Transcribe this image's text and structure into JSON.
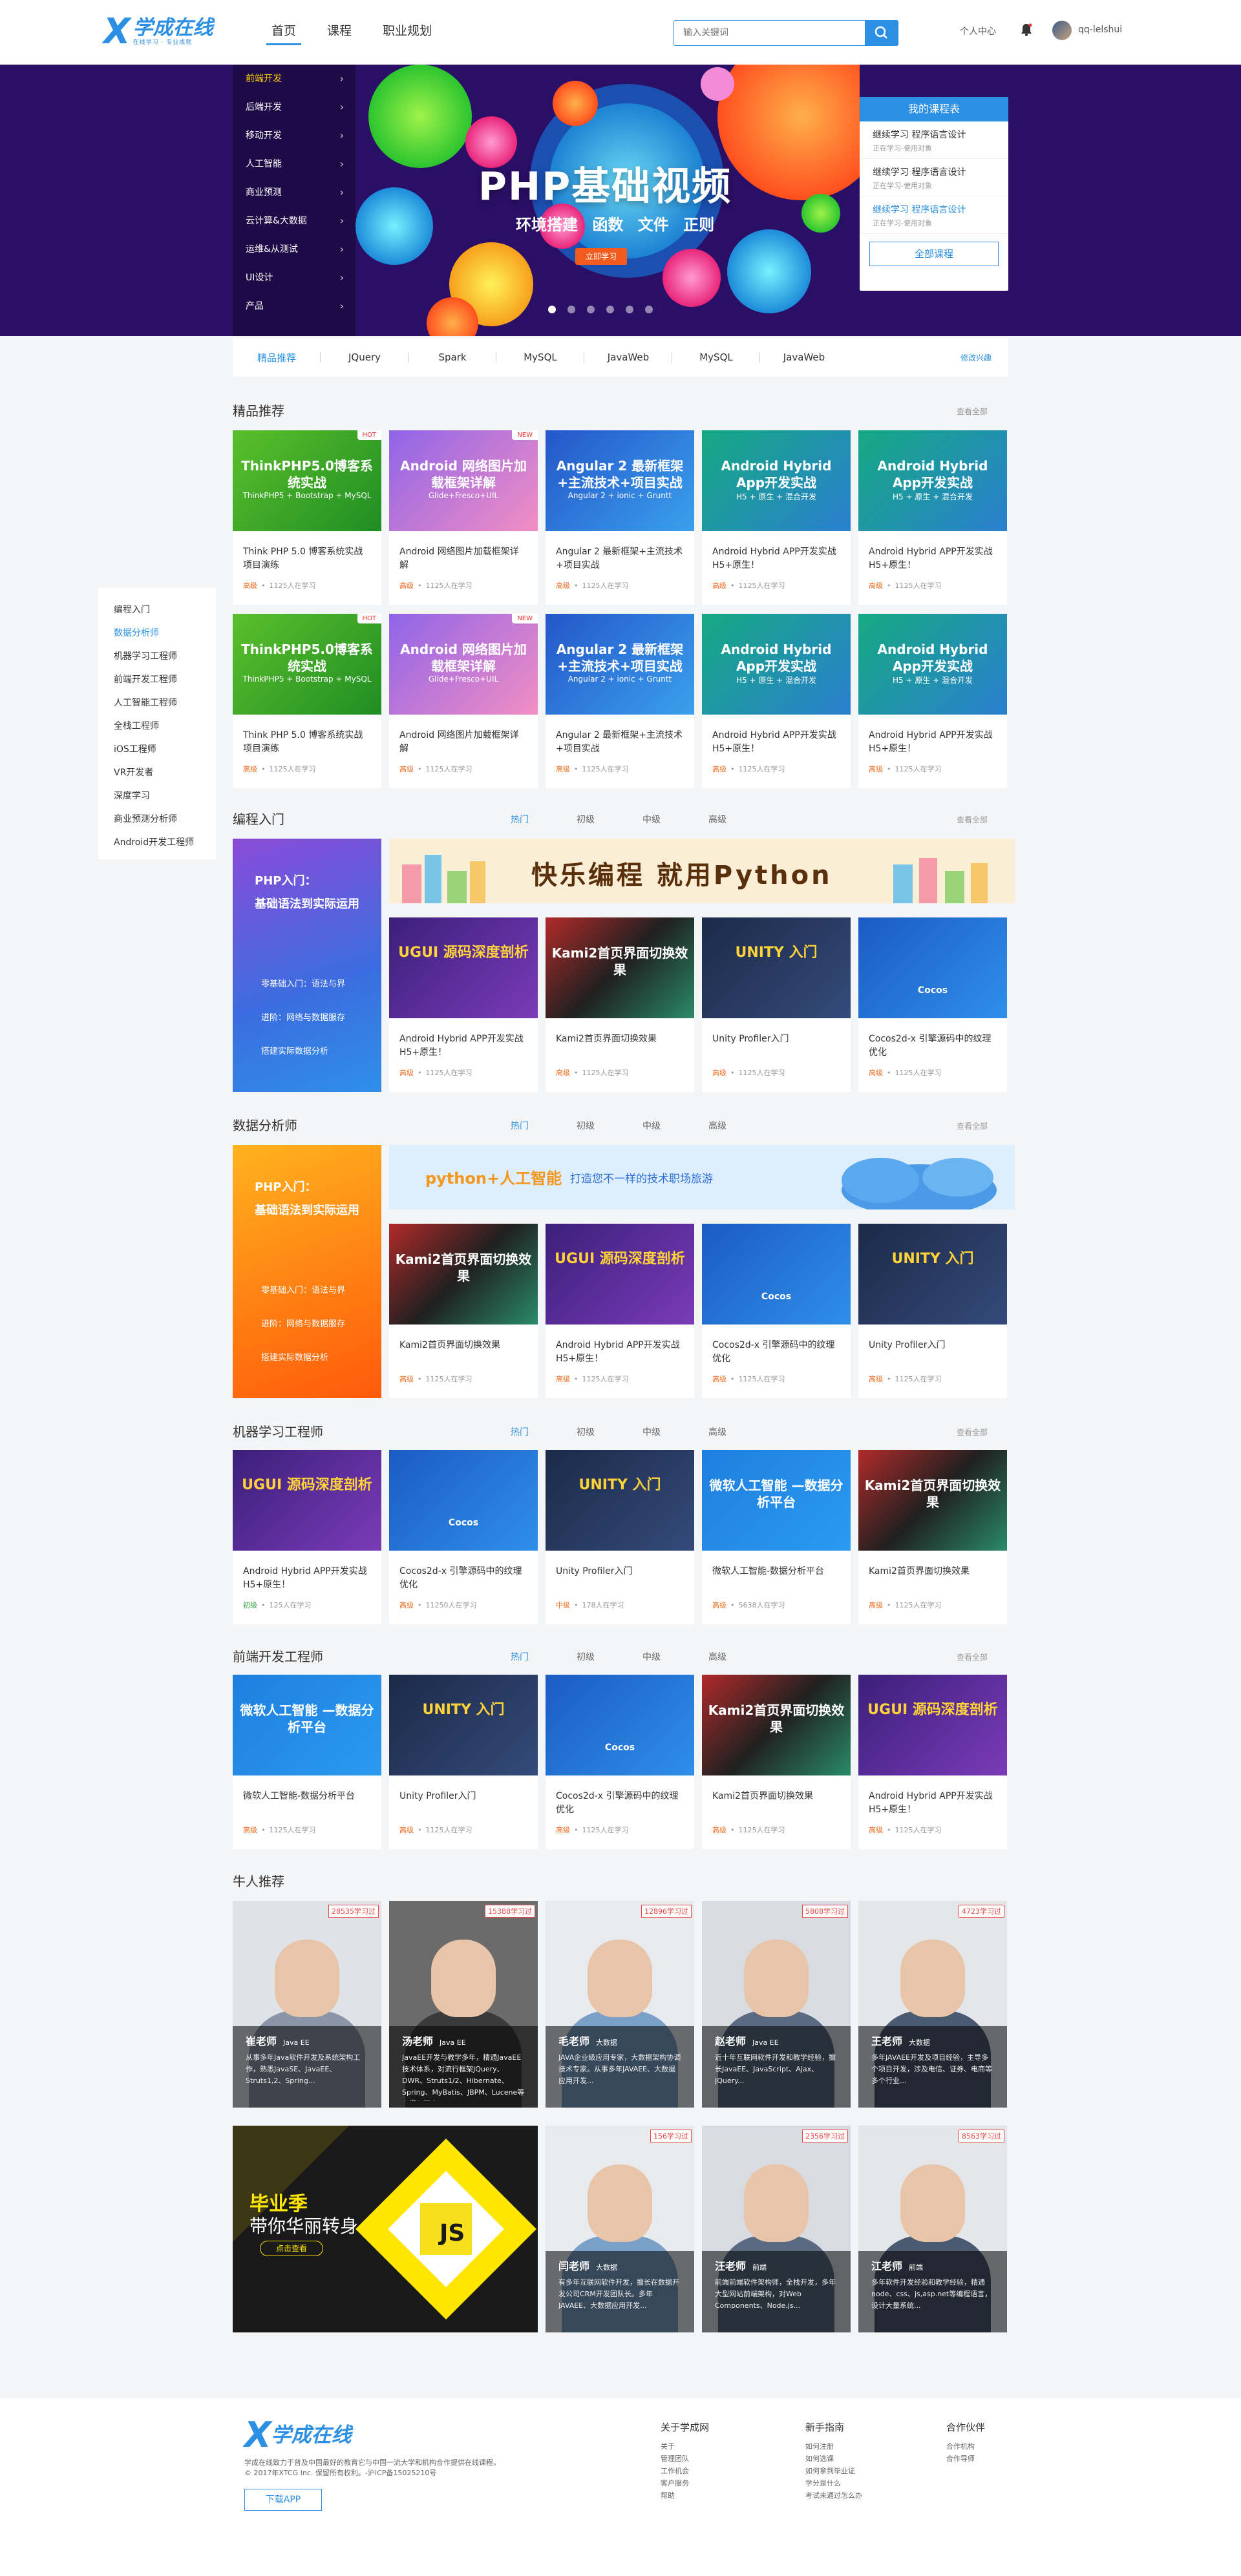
{
  "header": {
    "logo_main": "学成在线",
    "logo_sub": "在线学习 · 专业成就",
    "nav": [
      "首页",
      "课程",
      "职业规划"
    ],
    "search_placeholder": "输入关键词",
    "personal_center": "个人中心",
    "username": "qq-lelshui"
  },
  "banner": {
    "categories": [
      "前端开发",
      "后端开发",
      "移动开发",
      "人工智能",
      "商业预测",
      "云计算&大数据",
      "运维&从测试",
      "UI设计",
      "产品"
    ],
    "slide_title": "PHP基础视频",
    "slide_sub": "环境搭建 函数 文件 正则",
    "slide_button": "立即学习",
    "my_courses": {
      "title": "我的课程表",
      "items": [
        {
          "title": "继续学习 程序语言设计",
          "sub": "正在学习-使用对象"
        },
        {
          "title": "继续学习 程序语言设计",
          "sub": "正在学习-使用对象"
        },
        {
          "title": "继续学习 程序语言设计",
          "sub": "正在学习-使用对象"
        }
      ],
      "all": "全部课程"
    }
  },
  "tagbar": {
    "tags": [
      "精品推荐",
      "JQuery",
      "Spark",
      "MySQL",
      "JavaWeb",
      "MySQL",
      "JavaWeb"
    ],
    "more": "修改兴趣"
  },
  "sidenav": [
    "编程入门",
    "数据分析师",
    "机器学习工程师",
    "前端开发工程师",
    "人工智能工程师",
    "全栈工程师",
    "iOS工程师",
    "VR开发者",
    "深度学习",
    "商业预测分析师",
    "Android开发工程师"
  ],
  "sections": {
    "featured": {
      "title": "精品推荐",
      "more": "查看全部"
    },
    "intro": {
      "title": "编程入门",
      "more": "查看全部",
      "tabs": [
        "热门",
        "初级",
        "中级",
        "高级"
      ]
    },
    "data": {
      "title": "数据分析师",
      "more": "查看全部",
      "tabs": [
        "热门",
        "初级",
        "中级",
        "高级"
      ]
    },
    "ml": {
      "title": "机器学习工程师",
      "more": "查看全部",
      "tabs": [
        "热门",
        "初级",
        "中级",
        "高级"
      ]
    },
    "fe": {
      "title": "前端开发工程师",
      "more": "查看全部",
      "tabs": [
        "热门",
        "初级",
        "中级",
        "高级"
      ]
    },
    "teachers": {
      "title": "牛人推荐"
    }
  },
  "featured_cards": [
    {
      "cover": "ThinkPHP5.0博客系统实战",
      "cover_sub": "ThinkPHP5 + Bootstrap + MySQL",
      "badge": "HOT",
      "title": "Think PHP 5.0 博客系统实战项目演练",
      "level": "高级",
      "count": "1125人在学习"
    },
    {
      "cover": "Android 网络图片加载框架详解",
      "cover_sub": "Glide+Fresco+UIL",
      "badge": "NEW",
      "title": "Android 网络图片加载框架详解",
      "level": "高级",
      "count": "1125人在学习"
    },
    {
      "cover": "Angular 2 最新框架+主流技术+项目实战",
      "cover_sub": "Angular 2 + ionic + Gruntt",
      "badge": "",
      "title": "Angular 2 最新框架+主流技术+项目实战",
      "level": "高级",
      "count": "1125人在学习"
    },
    {
      "cover": "Android Hybrid App开发实战",
      "cover_sub": "H5 + 原生 + 混合开发",
      "badge": "",
      "title": "Android Hybrid APP开发实战 H5+原生！",
      "level": "高级",
      "count": "1125人在学习"
    },
    {
      "cover": "Android Hybrid App开发实战",
      "cover_sub": "H5 + 原生 + 混合开发",
      "badge": "",
      "title": "Android Hybrid APP开发实战 H5+原生！",
      "level": "高级",
      "count": "1125人在学习"
    }
  ],
  "intro_left": {
    "title1": "PHP入门：",
    "title2": "基础语法到实际运用",
    "list": [
      "零基础入门：语法与界",
      "进阶：网络与数据服存",
      "搭建实际数据分析"
    ]
  },
  "intro_banner": "快乐编程  就用Python",
  "intro_cards": [
    {
      "cover": "UGUI 源码深度剖析",
      "title": "Android Hybrid APP开发实战 H5+原生！",
      "level": "高级",
      "count": "1125人在学习"
    },
    {
      "cover": "Kami2首页界面切换效果",
      "title": "Kami2首页界面切换效果",
      "level": "高级",
      "count": "1125人在学习"
    },
    {
      "cover": "UNITY 入门",
      "title": "Unity Profiler入门",
      "level": "高级",
      "count": "1125人在学习"
    },
    {
      "cover": "Cocos",
      "title": "Cocos2d-x 引擎源码中的纹理优化",
      "level": "高级",
      "count": "1125人在学习"
    }
  ],
  "data_left": {
    "title1": "PHP入门：",
    "title2": "基础语法到实际运用",
    "list": [
      "零基础入门：语法与界",
      "进阶：网络与数据服存",
      "搭建实际数据分析"
    ]
  },
  "data_banner": {
    "a": "python+人工智能",
    "b": "打造您不一样的技术职场旅游"
  },
  "data_cards": [
    {
      "cover": "Kami2首页界面切换效果",
      "title": "Kami2首页界面切换效果",
      "level": "高级",
      "count": "1125人在学习"
    },
    {
      "cover": "UGUI 源码深度剖析",
      "title": "Android Hybrid APP开发实战 H5+原生！",
      "level": "高级",
      "count": "1125人在学习"
    },
    {
      "cover": "Cocos",
      "title": "Cocos2d-x 引擎源码中的纹理优化",
      "level": "高级",
      "count": "1125人在学习"
    },
    {
      "cover": "UNITY 入门",
      "title": "Unity Profiler入门",
      "level": "高级",
      "count": "1125人在学习"
    }
  ],
  "ml_cards": [
    {
      "cover": "UGUI 源码深度剖析",
      "title": "Android Hybrid APP开发实战 H5+原生！",
      "level": "初级",
      "count": "125人在学习"
    },
    {
      "cover": "Cocos",
      "title": "Cocos2d-x 引擎源码中的纹理优化",
      "level": "高级",
      "count": "11250人在学习"
    },
    {
      "cover": "UNITY 入门",
      "title": "Unity Profiler入门",
      "level": "中级",
      "count": "178人在学习"
    },
    {
      "cover": "微软人工智能 —数据分析平台",
      "title": "微软人工智能-数据分析平台",
      "level": "高级",
      "count": "5638人在学习"
    },
    {
      "cover": "Kami2首页界面切换效果",
      "title": "Kami2首页界面切换效果",
      "level": "高级",
      "count": "1125人在学习"
    }
  ],
  "fe_cards": [
    {
      "cover": "微软人工智能 —数据分析平台",
      "title": "微软人工智能-数据分析平台",
      "level": "高级",
      "count": "1125人在学习"
    },
    {
      "cover": "UNITY 入门",
      "title": "Unity Profiler入门",
      "level": "高级",
      "count": "1125人在学习"
    },
    {
      "cover": "Cocos",
      "title": "Cocos2d-x 引擎源码中的纹理优化",
      "level": "高级",
      "count": "1125人在学习"
    },
    {
      "cover": "Kami2首页界面切换效果",
      "title": "Kami2首页界面切换效果",
      "level": "高级",
      "count": "1125人在学习"
    },
    {
      "cover": "UGUI 源码深度剖析",
      "title": "Android Hybrid APP开发实战 H5+原生！",
      "level": "高级",
      "count": "1125人在学习"
    }
  ],
  "teachers_row1": [
    {
      "name": "崔老师",
      "tag": "Java EE",
      "count": "28535学习过",
      "desc": "从事多年Java软件开发及系统架构工作，熟悉JavaSE、JavaEE、Struts1,2、Spring..."
    },
    {
      "name": "汤老师",
      "tag": "Java EE",
      "count": "15388学习过",
      "desc": "JavaEE开发与教学多年，精通JavaEE技术体系，对流行框架JQuery、DWR、Struts1/2、Hibernate、Spring、MyBatis、JBPM、Lucene等有深入研究。"
    },
    {
      "name": "毛老师",
      "tag": "大数据",
      "count": "12896学习过",
      "desc": "JAVA企业级应用专家，大数据架构协调技术专家。从事多年JAVAEE、大数据应用开发..."
    },
    {
      "name": "赵老师",
      "tag": "Java EE",
      "count": "5808学习过",
      "desc": "近十年互联网软件开发和教学经验，擅长JavaEE、JavaScript、Ajax、JQuery..."
    },
    {
      "name": "王老师",
      "tag": "大数据",
      "count": "4723学习过",
      "desc": "多年JAVAEE开发及项目经验，主导多个项目开发，涉及电信、证券、电商等多个行业..."
    }
  ],
  "grad_banner": {
    "l1": "毕业季",
    "l2": "带你华丽转身",
    "btn": "点击查看"
  },
  "teachers_row2": [
    {
      "name": "闫老师",
      "tag": "大数据",
      "count": "156学习过",
      "desc": "有多年互联网软件开发，擅长在数据开发公司CRM开发团队长。多年JAVAEE、大数据应用开发..."
    },
    {
      "name": "汪老师",
      "tag": "前端",
      "count": "2356学习过",
      "desc": "前端前端软件架构师，全栈开发，多年大型网站前端架构，对Web Components、Node.js..."
    },
    {
      "name": "江老师",
      "tag": "前端",
      "count": "8563学习过",
      "desc": "多年软件开发经验和教学经验，精通node、css、js,asp.net等编程语言，设计大量系统..."
    }
  ],
  "footer": {
    "logo": "学成在线",
    "desc1": "学成在线致力于普及中国最好的教育它与中国一流大学和机构合作提供在线课程。",
    "desc2": "© 2017年XTCG Inc. 保留所有权利。-沪ICP备15025210号",
    "app": "下载APP",
    "cols": [
      {
        "h": "关于学成网",
        "l": [
          "关于",
          "管理团队",
          "工作机会",
          "客户服务",
          "帮助"
        ]
      },
      {
        "h": "新手指南",
        "l": [
          "如何注册",
          "如何选课",
          "如何拿到毕业证",
          "学分是什么",
          "考试未通过怎么办"
        ]
      },
      {
        "h": "合作伙伴",
        "l": [
          "合作机构",
          "合作导师"
        ]
      }
    ]
  }
}
